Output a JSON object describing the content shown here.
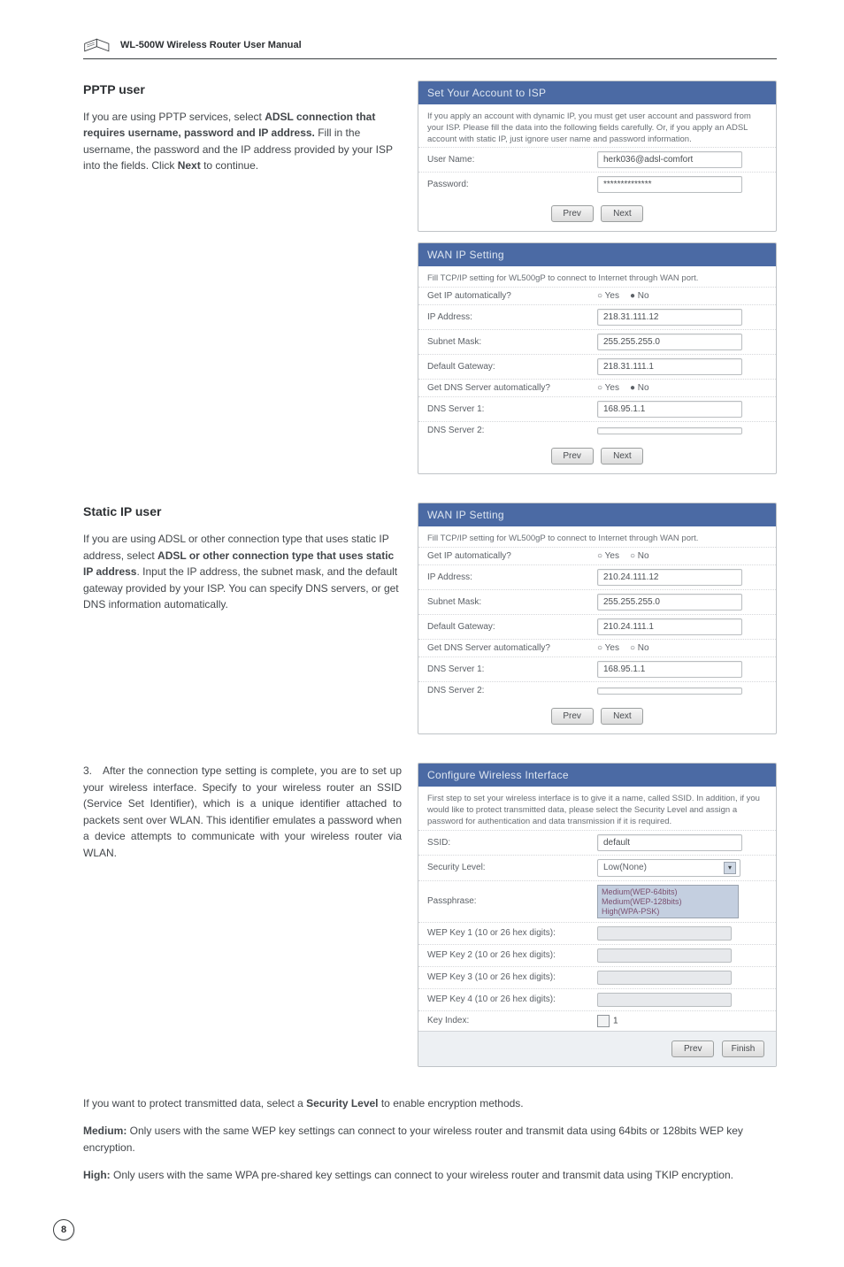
{
  "header": {
    "title": "WL-500W Wireless Router User Manual"
  },
  "pptp": {
    "heading": "PPTP user",
    "body": "If you are using PPTP services, select <b>ADSL connection that requires username, password and IP address.</b> Fill in the username, the password and the IP address provided by your ISP into the fields. Click <b>Next</b> to continue."
  },
  "static": {
    "heading": "Static IP user",
    "body": "If you are using ADSL or other connection type that uses static IP address, select <b>ADSL or other connection type that uses static IP address</b>. Input the IP address, the subnet mask, and the default gateway provided by your ISP. You can specify DNS servers, or get DNS information automatically."
  },
  "step3": {
    "body": "3. After the connection type setting is complete, you are to set up your wireless interface. Specify to your wireless router an SSID (Service Set Identifier), which is a unique identifier attached to packets sent over WLAN. This identifier emulates a password when a device attempts to communicate with your wireless router via WLAN."
  },
  "panelA": {
    "title": "Set Your Account to ISP",
    "desc": "If you apply an account with dynamic IP, you must get user account and password from your ISP. Please fill the data into the following fields carefully. Or, if you apply an ADSL account with static IP, just ignore user name and password information.",
    "fields": {
      "user_label": "User Name:",
      "user_value": "herk036@adsl-comfort",
      "pass_label": "Password:",
      "pass_value": "**************"
    },
    "prev": "Prev",
    "next": "Next"
  },
  "panelB": {
    "title": "WAN IP Setting",
    "desc": "Fill TCP/IP setting for WL500gP to connect to Internet through WAN port.",
    "fields": {
      "autoip_label": "Get IP automatically?",
      "autoip_yes": "Yes",
      "autoip_no": "No",
      "ip_label": "IP Address:",
      "ip_value": "218.31.111.12",
      "mask_label": "Subnet Mask:",
      "mask_value": "255.255.255.0",
      "gw_label": "Default Gateway:",
      "gw_value": "218.31.111.1",
      "autodns_label": "Get DNS Server automatically?",
      "autodns_yes": "Yes",
      "autodns_no": "No",
      "dns1_label": "DNS Server 1:",
      "dns1_value": "168.95.1.1",
      "dns2_label": "DNS Server 2:",
      "dns2_value": ""
    },
    "prev": "Prev",
    "next": "Next"
  },
  "panelC": {
    "title": "WAN IP Setting",
    "desc": "Fill TCP/IP setting for WL500gP to connect to Internet through WAN port.",
    "fields": {
      "autoip_label": "Get IP automatically?",
      "autoip_yes": "Yes",
      "autoip_no": "No",
      "ip_label": "IP Address:",
      "ip_value": "210.24.111.12",
      "mask_label": "Subnet Mask:",
      "mask_value": "255.255.255.0",
      "gw_label": "Default Gateway:",
      "gw_value": "210.24.111.1",
      "autodns_label": "Get DNS Server automatically?",
      "autodns_yes": "Yes",
      "autodns_no": "No",
      "dns1_label": "DNS Server 1:",
      "dns1_value": "168.95.1.1",
      "dns2_label": "DNS Server 2:",
      "dns2_value": ""
    },
    "prev": "Prev",
    "next": "Next"
  },
  "panelD": {
    "title": "Configure Wireless Interface",
    "desc": "First step to set your wireless interface is to give it a name, called SSID. In addition, if you would like to protect transmitted data, please select the Security Level and assign a password for authentication and data transmission if it is required.",
    "fields": {
      "ssid_label": "SSID:",
      "ssid_value": "default",
      "sec_label": "Security Level:",
      "sec_value": "Low(None)",
      "pass_label": "Passphrase:",
      "pass_opt1": "Medium(WEP-64bits)",
      "pass_opt2": "Medium(WEP-128bits)",
      "pass_opt3": "High(WPA-PSK)",
      "k1_label": "WEP Key 1 (10 or 26 hex digits):",
      "k2_label": "WEP Key 2 (10 or 26 hex digits):",
      "k3_label": "WEP Key 3 (10 or 26 hex digits):",
      "k4_label": "WEP Key 4 (10 or 26 hex digits):",
      "keyidx_label": "Key Index:",
      "keyidx_value": "1"
    },
    "prev": "Prev",
    "finish": "Finish"
  },
  "below": {
    "p1": "If you want to protect transmitted data, select a <b>Security Level</b> to enable encryption methods.",
    "p2": "<b>Medium:</b> Only users with the same WEP key settings can connect to your wireless router and transmit data using 64bits or 128bits WEP key encryption.",
    "p3": "<b>High:</b> Only users with the same WPA pre-shared key settings can connect to your wireless router and transmit data using TKIP encryption."
  },
  "pagenum": "8"
}
